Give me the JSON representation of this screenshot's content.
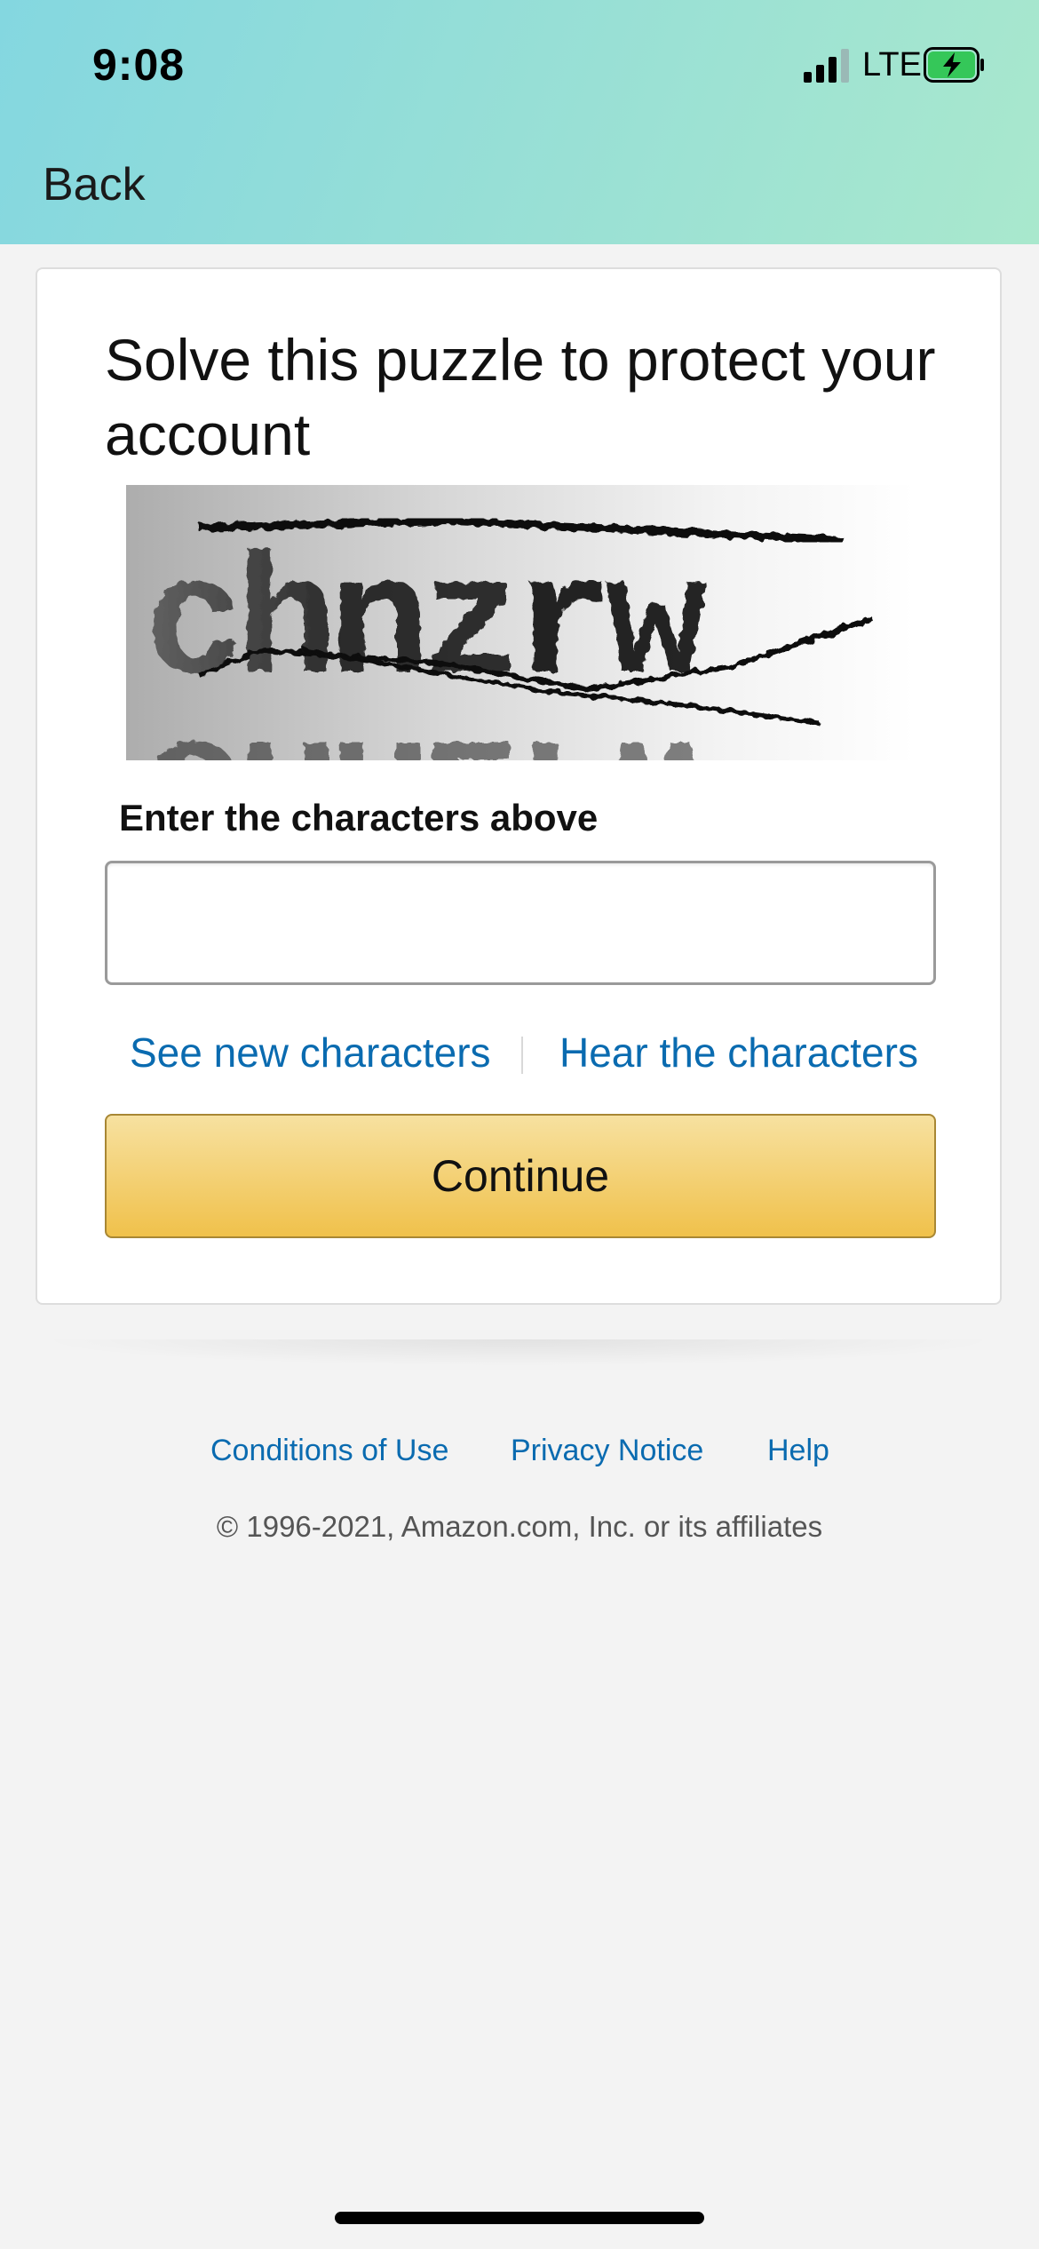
{
  "status_bar": {
    "time": "9:08",
    "network": "LTE",
    "signal_bars_active": 3,
    "battery_state": "charging",
    "battery_color": "#35c759"
  },
  "nav": {
    "back_label": "Back"
  },
  "puzzle": {
    "title": "Solve this puzzle to protect your account",
    "captcha_text": "chnzrw",
    "input_label": "Enter the characters above",
    "input_value": "",
    "input_placeholder": "",
    "new_characters_link": "See new characters",
    "hear_characters_link": "Hear the characters",
    "continue_label": "Continue"
  },
  "footer": {
    "links": [
      "Conditions of Use",
      "Privacy Notice",
      "Help"
    ],
    "copyright": "© 1996-2021, Amazon.com, Inc. or its affiliates"
  },
  "colors": {
    "link": "#0a6bb0",
    "button_top": "#f7e1a0",
    "button_bottom": "#f0c14b",
    "header_start": "#84d7e0",
    "header_end": "#a9e8cd"
  }
}
